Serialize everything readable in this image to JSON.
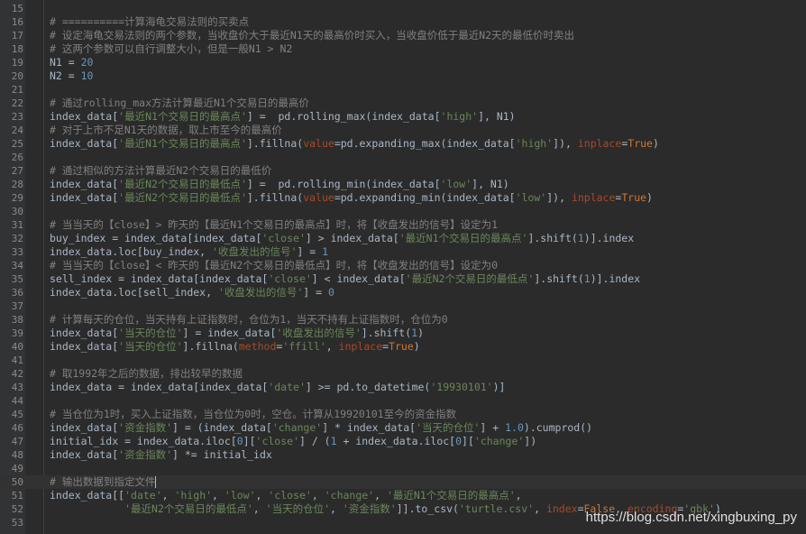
{
  "editor": {
    "lines": [
      {
        "n": "15",
        "t": ""
      },
      {
        "n": "16",
        "t": "# ==========计算海龟交易法则的买卖点"
      },
      {
        "n": "17",
        "t": "# 设定海龟交易法则的两个参数，当收盘价大于最近N1天的最高价时买入，当收盘价低于最近N2天的最低价时卖出"
      },
      {
        "n": "18",
        "t": "# 这两个参数可以自行调整大小，但是一般N1 > N2"
      },
      {
        "n": "19",
        "t": "N1 = 20"
      },
      {
        "n": "20",
        "t": "N2 = 10"
      },
      {
        "n": "21",
        "t": ""
      },
      {
        "n": "22",
        "t": "# 通过rolling_max方法计算最近N1个交易日的最高价"
      },
      {
        "n": "23",
        "t": "index_data['最近N1个交易日的最高点'] =  pd.rolling_max(index_data['high'], N1)"
      },
      {
        "n": "24",
        "t": "# 对于上市不足N1天的数据，取上市至今的最高价"
      },
      {
        "n": "25",
        "t": "index_data['最近N1个交易日的最高点'].fillna(value=pd.expanding_max(index_data['high']), inplace=True)"
      },
      {
        "n": "26",
        "t": ""
      },
      {
        "n": "27",
        "t": "# 通过相似的方法计算最近N2个交易日的最低价"
      },
      {
        "n": "28",
        "t": "index_data['最近N2个交易日的最低点'] =  pd.rolling_min(index_data['low'], N1)"
      },
      {
        "n": "29",
        "t": "index_data['最近N2个交易日的最低点'].fillna(value=pd.expanding_min(index_data['low']), inplace=True)"
      },
      {
        "n": "30",
        "t": ""
      },
      {
        "n": "31",
        "t": "# 当当天的【close】> 昨天的【最近N1个交易日的最高点】时，将【收盘发出的信号】设定为1"
      },
      {
        "n": "32",
        "t": "buy_index = index_data[index_data['close'] > index_data['最近N1个交易日的最高点'].shift(1)].index"
      },
      {
        "n": "33",
        "t": "index_data.loc[buy_index, '收盘发出的信号'] = 1"
      },
      {
        "n": "34",
        "t": "# 当当天的【close】< 昨天的【最近N2个交易日的最低点】时，将【收盘发出的信号】设定为0"
      },
      {
        "n": "35",
        "t": "sell_index = index_data[index_data['close'] < index_data['最近N2个交易日的最低点'].shift(1)].index"
      },
      {
        "n": "36",
        "t": "index_data.loc[sell_index, '收盘发出的信号'] = 0"
      },
      {
        "n": "37",
        "t": ""
      },
      {
        "n": "38",
        "t": "# 计算每天的仓位，当天持有上证指数时，仓位为1，当天不持有上证指数时，仓位为0"
      },
      {
        "n": "39",
        "t": "index_data['当天的仓位'] = index_data['收盘发出的信号'].shift(1)"
      },
      {
        "n": "40",
        "t": "index_data['当天的仓位'].fillna(method='ffill', inplace=True)"
      },
      {
        "n": "41",
        "t": ""
      },
      {
        "n": "42",
        "t": "# 取1992年之后的数据，排出较早的数据"
      },
      {
        "n": "43",
        "t": "index_data = index_data[index_data['date'] >= pd.to_datetime('19930101')]"
      },
      {
        "n": "44",
        "t": ""
      },
      {
        "n": "45",
        "t": "# 当仓位为1时，买入上证指数，当仓位为0时，空仓。计算从19920101至今的资金指数"
      },
      {
        "n": "46",
        "t": "index_data['资金指数'] = (index_data['change'] * index_data['当天的仓位'] + 1.0).cumprod()"
      },
      {
        "n": "47",
        "t": "initial_idx = index_data.iloc[0]['close'] / (1 + index_data.iloc[0]['change'])"
      },
      {
        "n": "48",
        "t": "index_data['资金指数'] *= initial_idx"
      },
      {
        "n": "49",
        "t": ""
      },
      {
        "n": "50",
        "t": "# 输出数据到指定文件"
      },
      {
        "n": "51",
        "t": "index_data[['date', 'high', 'low', 'close', 'change', '最近N1个交易日的最高点',"
      },
      {
        "n": "52",
        "t": "            '最近N2个交易日的最低点', '当天的仓位', '资金指数']].to_csv('turtle.csv', index=False, encoding='gbk')"
      },
      {
        "n": "53",
        "t": ""
      }
    ]
  },
  "watermark": "https://blog.csdn.net/xingbuxing_py"
}
